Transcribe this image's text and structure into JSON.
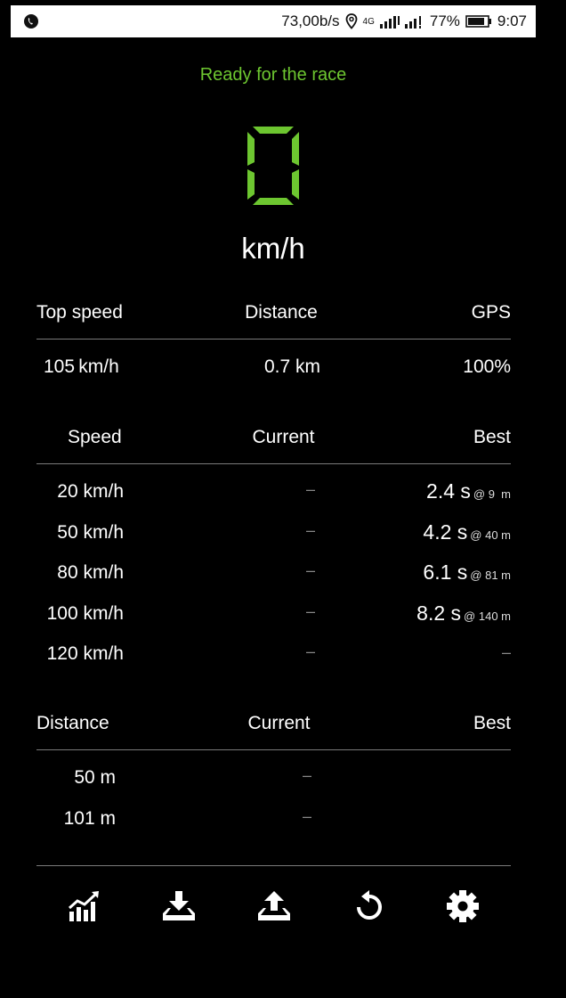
{
  "status_bar": {
    "speed": "73,00b/s",
    "net": "4G",
    "battery": "77%",
    "time": "9:07"
  },
  "status_text": "Ready for the race",
  "speed_value": "0",
  "speed_unit": "km/h",
  "colors": {
    "accent": "#6dc630",
    "background": "#000000"
  },
  "summary": {
    "headers": [
      "Top speed",
      "Distance",
      "GPS"
    ],
    "values": [
      "105 km/h",
      "0.7 km",
      "100%"
    ]
  },
  "speed_table": {
    "headers": [
      "Speed",
      "Current",
      "Best"
    ],
    "rows": [
      {
        "target": "20 km/h",
        "current": "–",
        "best": "2.4 s",
        "best_at": "@ 9  m"
      },
      {
        "target": "50 km/h",
        "current": "–",
        "best": "4.2 s",
        "best_at": "@ 40 m"
      },
      {
        "target": "80 km/h",
        "current": "–",
        "best": "6.1 s",
        "best_at": "@ 81 m"
      },
      {
        "target": "100 km/h",
        "current": "–",
        "best": "8.2 s",
        "best_at": "@ 140 m"
      },
      {
        "target": "120 km/h",
        "current": "–",
        "best": "–",
        "best_at": ""
      }
    ]
  },
  "distance_table": {
    "headers": [
      "Distance",
      "Current",
      "Best"
    ],
    "rows": [
      {
        "target": "50 m",
        "current": "–",
        "best": ""
      },
      {
        "target": "101 m",
        "current": "–",
        "best": ""
      }
    ]
  },
  "toolbar": {
    "icons": [
      "chart-icon",
      "download-icon",
      "upload-icon",
      "reset-icon",
      "settings-icon"
    ]
  }
}
